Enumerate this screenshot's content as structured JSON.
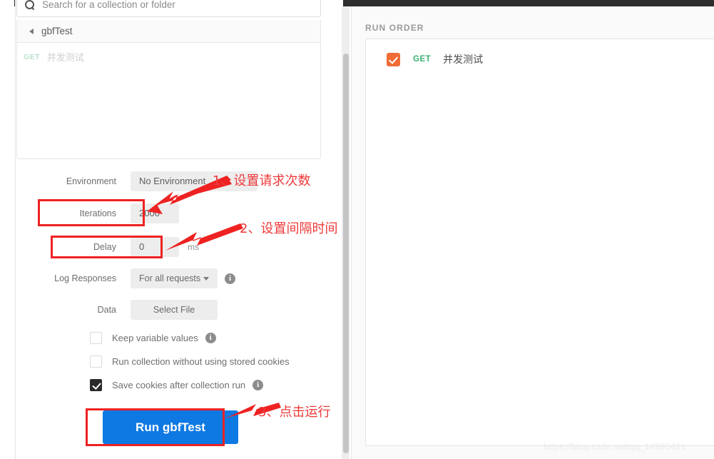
{
  "search": {
    "placeholder": "Search for a collection or folder",
    "icon": "search-icon"
  },
  "breadcrumb": {
    "collection": "gbfTest",
    "back_icon": "left-triangle-icon"
  },
  "request_list": [
    {
      "method": "GET",
      "name": "并发测试"
    }
  ],
  "form": {
    "environment": {
      "label": "Environment",
      "value": "No Environment"
    },
    "iterations": {
      "label": "Iterations",
      "value": "2000"
    },
    "delay": {
      "label": "Delay",
      "value": "0",
      "unit": "ms"
    },
    "log_responses": {
      "label": "Log Responses",
      "value": "For all requests",
      "caret_icon": "chevron-down-icon",
      "info_icon": "info-icon"
    },
    "data": {
      "label": "Data",
      "button": "Select File"
    },
    "checkboxes": [
      {
        "label": "Keep variable values",
        "checked": false,
        "info": true
      },
      {
        "label": "Run collection without using stored cookies",
        "checked": false,
        "info": false
      },
      {
        "label": "Save cookies after collection run",
        "checked": true,
        "info": true
      }
    ],
    "run_button": "Run gbfTest"
  },
  "right_panel": {
    "title": "RUN ORDER",
    "rows": [
      {
        "method": "GET",
        "name": "并发测试",
        "checked": true,
        "check_color": "#ef6c36",
        "method_color": "#3bb273"
      }
    ]
  },
  "annotations": [
    {
      "index": "1",
      "text": "1、设置请求次数"
    },
    {
      "index": "2",
      "text": "2、设置间隔时间"
    },
    {
      "index": "3",
      "text": "3、点击运行"
    }
  ],
  "colors": {
    "accent_blue": "#0e79e3",
    "annotation_red": "#ef3a3a",
    "check_orange": "#ef6c36",
    "method_green": "#3bb273"
  },
  "watermark": "https://blog.csdn.net/qq_14996421"
}
